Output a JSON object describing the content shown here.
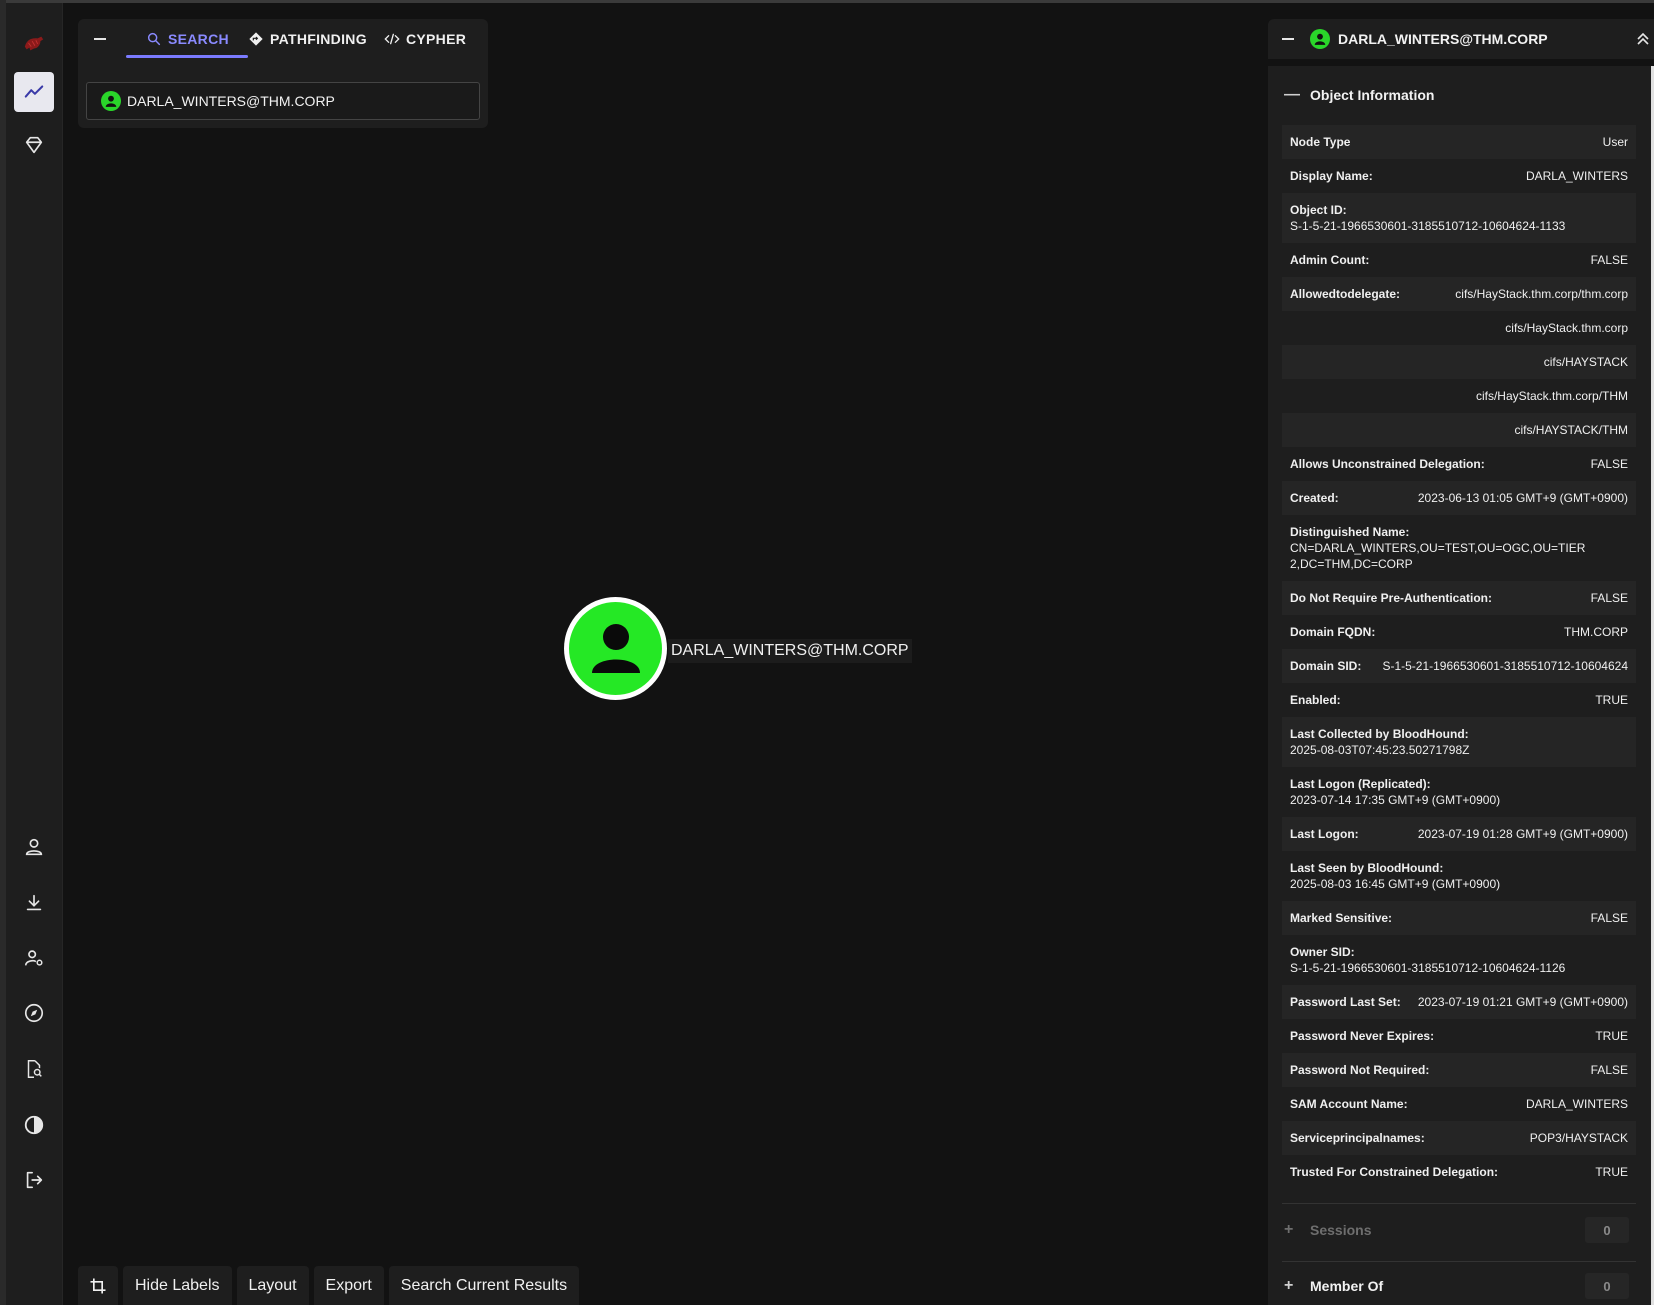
{
  "explore": {
    "tabs": [
      {
        "label": "SEARCH",
        "active": true
      },
      {
        "label": "PATHFINDING",
        "active": false
      },
      {
        "label": "CYPHER",
        "active": false
      }
    ],
    "search_value": "DARLA_WINTERS@THM.CORP"
  },
  "graph": {
    "node_label": "DARLA_WINTERS@THM.CORP",
    "node_color": "#25e825"
  },
  "bottom_bar": {
    "hide_labels": "Hide Labels",
    "layout": "Layout",
    "export": "Export",
    "search_current": "Search Current Results"
  },
  "entity": {
    "title": "DARLA_WINTERS@THM.CORP",
    "object_info_title": "Object Information",
    "properties": [
      {
        "key": "Node Type",
        "value": "User"
      },
      {
        "key": "Display Name:",
        "value": "DARLA_WINTERS"
      },
      {
        "key": "Object ID:",
        "value": "S-1-5-21-1966530601-3185510712-10604624-1133"
      },
      {
        "key": "Admin Count:",
        "value": "FALSE"
      },
      {
        "key": "Allowedtodelegate:",
        "value": "cifs/HayStack.thm.corp/thm.corp"
      },
      {
        "key": "",
        "value": "cifs/HayStack.thm.corp"
      },
      {
        "key": "",
        "value": "cifs/HAYSTACK"
      },
      {
        "key": "",
        "value": "cifs/HayStack.thm.corp/THM"
      },
      {
        "key": "",
        "value": "cifs/HAYSTACK/THM"
      },
      {
        "key": "Allows Unconstrained Delegation:",
        "value": "FALSE"
      },
      {
        "key": "Created:",
        "value": "2023-06-13 01:05 GMT+9 (GMT+0900)"
      },
      {
        "key": "Distinguished Name:",
        "value": "CN=DARLA_WINTERS,OU=TEST,OU=OGC,OU=TIER 2,DC=THM,DC=CORP"
      },
      {
        "key": "Do Not Require Pre-Authentication:",
        "value": "FALSE"
      },
      {
        "key": "Domain FQDN:",
        "value": "THM.CORP"
      },
      {
        "key": "Domain SID:",
        "value": "S-1-5-21-1966530601-3185510712-10604624"
      },
      {
        "key": "Enabled:",
        "value": "TRUE"
      },
      {
        "key": "Last Collected by BloodHound:",
        "value": "2025-08-03T07:45:23.50271798Z"
      },
      {
        "key": "Last Logon (Replicated):",
        "value": "2023-07-14 17:35 GMT+9 (GMT+0900)"
      },
      {
        "key": "Last Logon:",
        "value": "2023-07-19 01:28 GMT+9 (GMT+0900)"
      },
      {
        "key": "Last Seen by BloodHound:",
        "value": "2025-08-03 16:45 GMT+9 (GMT+0900)"
      },
      {
        "key": "Marked Sensitive:",
        "value": "FALSE"
      },
      {
        "key": "Owner SID:",
        "value": "S-1-5-21-1966530601-3185510712-10604624-1126"
      },
      {
        "key": "Password Last Set:",
        "value": "2023-07-19 01:21 GMT+9 (GMT+0900)"
      },
      {
        "key": "Password Never Expires:",
        "value": "TRUE"
      },
      {
        "key": "Password Not Required:",
        "value": "FALSE"
      },
      {
        "key": "SAM Account Name:",
        "value": "DARLA_WINTERS"
      },
      {
        "key": "Serviceprincipalnames:",
        "value": "POP3/HAYSTACK"
      },
      {
        "key": "Trusted For Constrained Delegation:",
        "value": "TRUE"
      }
    ],
    "sessions_title": "Sessions",
    "sessions_count": "0",
    "member_of_title": "Member Of",
    "member_of_count": "0"
  },
  "icons": {
    "rail_top": [
      "bloodhound-logo-icon",
      "explore-icon",
      "diamond-icon"
    ],
    "rail_bottom": [
      "user-icon",
      "download-icon",
      "user-settings-icon",
      "compass-icon",
      "search-file-icon",
      "contrast-icon",
      "logout-icon"
    ]
  }
}
